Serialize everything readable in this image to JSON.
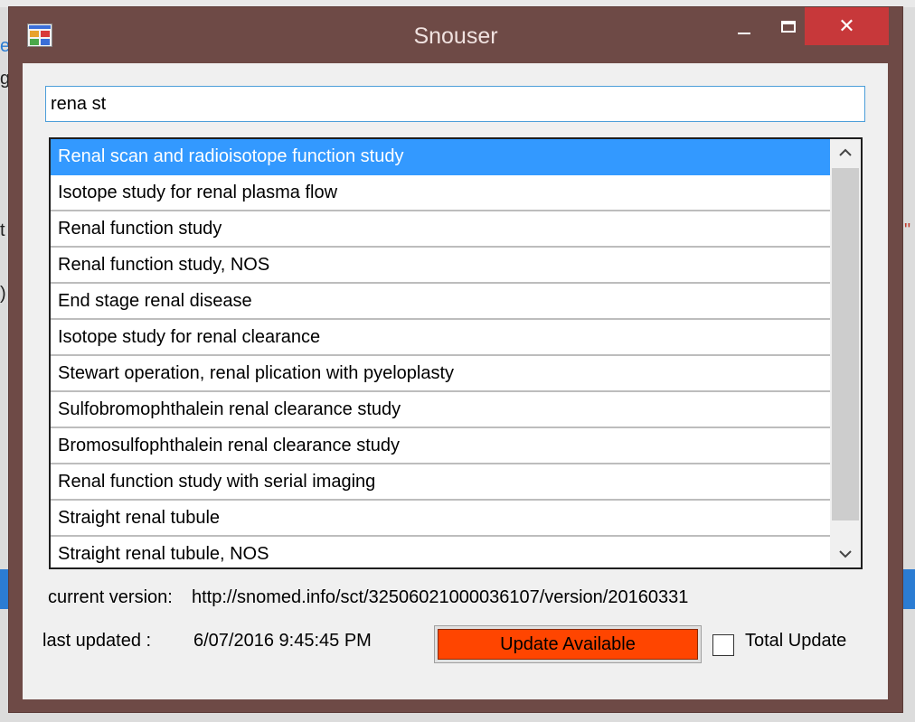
{
  "window": {
    "title": "Snouser",
    "close_glyph": "✕"
  },
  "search": {
    "value": "rena st"
  },
  "results": {
    "items": [
      "Renal scan and radioisotope function study",
      "Isotope study for renal plasma flow",
      "Renal function study",
      "Renal function study, NOS",
      "End stage renal disease",
      "Isotope study for renal clearance",
      "Stewart operation, renal plication with pyeloplasty",
      "Sulfobromophthalein renal clearance study",
      "Bromosulfophthalein renal clearance study",
      "Renal function study with serial imaging",
      "Straight renal tubule",
      "Straight renal tubule, NOS"
    ],
    "selected_index": 0
  },
  "footer": {
    "version_label": "current version:",
    "version_value": "http://snomed.info/sct/32506021000036107/version/20160331",
    "updated_label": "last updated :",
    "updated_value": "6/07/2016 9:45:45 PM",
    "update_button": "Update Available",
    "total_update_label": "Total Update",
    "total_update_checked": false
  },
  "colors": {
    "window_frame": "#6e4a46",
    "selection": "#3399ff",
    "update_button": "#ff4500",
    "close_button": "#c7383a"
  },
  "background": {
    "fragments": [
      "e",
      "g",
      "t",
      ")",
      "\""
    ]
  }
}
